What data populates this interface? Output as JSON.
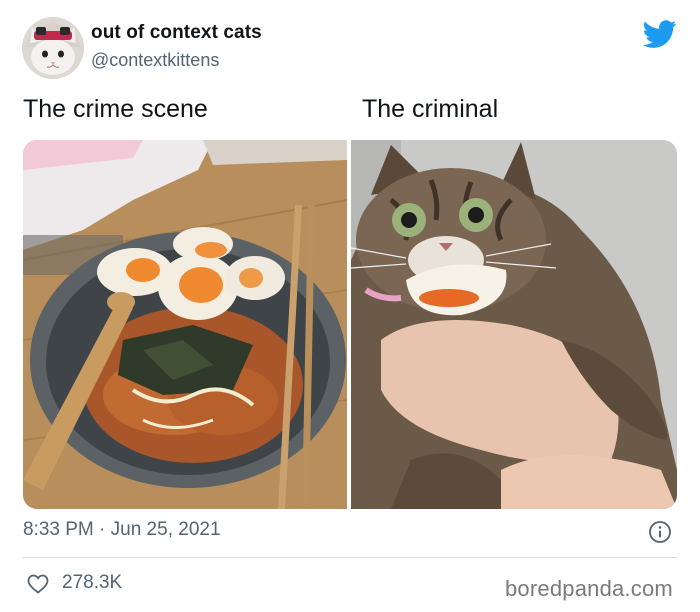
{
  "tweet": {
    "display_name": "out of context cats",
    "handle": "@contextkittens",
    "captions": {
      "left": "The crime scene",
      "right": "The criminal"
    },
    "timestamp": "8:33 PM · Jun 25, 2021",
    "like_count": "278.3K"
  },
  "watermark": "boredpanda.com",
  "icons": {
    "brand": "twitter-bird-icon",
    "info": "info-icon",
    "like": "heart-icon"
  },
  "colors": {
    "twitter_blue": "#1d9bf0",
    "secondary_text": "#536471",
    "divider": "#cfd9de"
  }
}
